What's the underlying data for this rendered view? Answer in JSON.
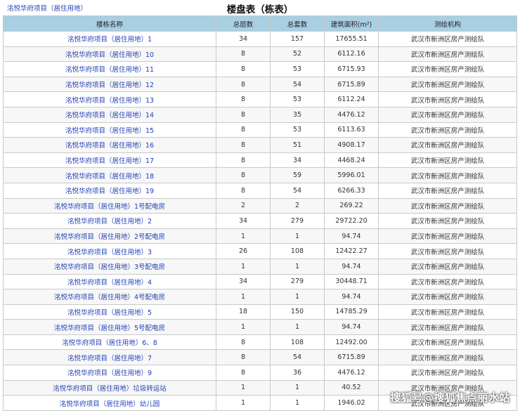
{
  "project": {
    "link_label": "洺悦华府项目（居住用地）"
  },
  "title": "楼盘表（栋表）",
  "table": {
    "headers": [
      "楼栋名称",
      "总层数",
      "总套数",
      "建筑面积(m²)",
      "测绘机构"
    ],
    "rows": [
      {
        "name": "洺悦华府项目（居住用地）1",
        "floors": "34",
        "units": "157",
        "area": "17655.51",
        "agency": "武汉市新洲区房产测绘队"
      },
      {
        "name": "洺悦华府项目（居住用地）10",
        "floors": "8",
        "units": "52",
        "area": "6112.16",
        "agency": "武汉市新洲区房产测绘队"
      },
      {
        "name": "洺悦华府项目（居住用地）11",
        "floors": "8",
        "units": "53",
        "area": "6715.93",
        "agency": "武汉市新洲区房产测绘队"
      },
      {
        "name": "洺悦华府项目（居住用地）12",
        "floors": "8",
        "units": "54",
        "area": "6715.89",
        "agency": "武汉市新洲区房产测绘队"
      },
      {
        "name": "洺悦华府项目（居住用地）13",
        "floors": "8",
        "units": "53",
        "area": "6112.24",
        "agency": "武汉市新洲区房产测绘队"
      },
      {
        "name": "洺悦华府项目（居住用地）14",
        "floors": "8",
        "units": "35",
        "area": "4476.12",
        "agency": "武汉市新洲区房产测绘队"
      },
      {
        "name": "洺悦华府项目（居住用地）15",
        "floors": "8",
        "units": "53",
        "area": "6113.63",
        "agency": "武汉市新洲区房产测绘队"
      },
      {
        "name": "洺悦华府项目（居住用地）16",
        "floors": "8",
        "units": "51",
        "area": "4908.17",
        "agency": "武汉市新洲区房产测绘队"
      },
      {
        "name": "洺悦华府项目（居住用地）17",
        "floors": "8",
        "units": "34",
        "area": "4468.24",
        "agency": "武汉市新洲区房产测绘队"
      },
      {
        "name": "洺悦华府项目（居住用地）18",
        "floors": "8",
        "units": "59",
        "area": "5996.01",
        "agency": "武汉市新洲区房产测绘队"
      },
      {
        "name": "洺悦华府项目（居住用地）19",
        "floors": "8",
        "units": "54",
        "area": "6266.33",
        "agency": "武汉市新洲区房产测绘队"
      },
      {
        "name": "洺悦华府项目（居住用地）1号配电房",
        "floors": "2",
        "units": "2",
        "area": "269.22",
        "agency": "武汉市新洲区房产测绘队"
      },
      {
        "name": "洺悦华府项目（居住用地）2",
        "floors": "34",
        "units": "279",
        "area": "29722.20",
        "agency": "武汉市新洲区房产测绘队"
      },
      {
        "name": "洺悦华府项目（居住用地）2号配电房",
        "floors": "1",
        "units": "1",
        "area": "94.74",
        "agency": "武汉市新洲区房产测绘队"
      },
      {
        "name": "洺悦华府项目（居住用地）3",
        "floors": "26",
        "units": "108",
        "area": "12422.27",
        "agency": "武汉市新洲区房产测绘队"
      },
      {
        "name": "洺悦华府项目（居住用地）3号配电房",
        "floors": "1",
        "units": "1",
        "area": "94.74",
        "agency": "武汉市新洲区房产测绘队"
      },
      {
        "name": "洺悦华府项目（居住用地）4",
        "floors": "34",
        "units": "279",
        "area": "30448.71",
        "agency": "武汉市新洲区房产测绘队"
      },
      {
        "name": "洺悦华府项目（居住用地）4号配电房",
        "floors": "1",
        "units": "1",
        "area": "94.74",
        "agency": "武汉市新洲区房产测绘队"
      },
      {
        "name": "洺悦华府项目（居住用地）5",
        "floors": "18",
        "units": "150",
        "area": "14785.29",
        "agency": "武汉市新洲区房产测绘队"
      },
      {
        "name": "洺悦华府项目（居住用地）5号配电房",
        "floors": "1",
        "units": "1",
        "area": "94.74",
        "agency": "武汉市新洲区房产测绘队"
      },
      {
        "name": "洺悦华府项目（居住用地）6、8",
        "floors": "8",
        "units": "108",
        "area": "12492.00",
        "agency": "武汉市新洲区房产测绘队"
      },
      {
        "name": "洺悦华府项目（居住用地）7",
        "floors": "8",
        "units": "54",
        "area": "6715.89",
        "agency": "武汉市新洲区房产测绘队"
      },
      {
        "name": "洺悦华府项目（居住用地）9",
        "floors": "8",
        "units": "36",
        "area": "4476.12",
        "agency": "武汉市新洲区房产测绘队"
      },
      {
        "name": "洺悦华府项目（居住用地）垃圾转运站",
        "floors": "1",
        "units": "1",
        "area": "40.52",
        "agency": "武汉市新洲区房产测绘队"
      },
      {
        "name": "洺悦华府项目（居住用地）幼儿园",
        "floors": "1",
        "units": "1",
        "area": "1946.02",
        "agency": "武汉市新洲区房产测绘队"
      }
    ]
  },
  "watermark": "搜狐号@搜狐焦点丽水站",
  "colors": {
    "link": "#1f3fb4",
    "header_bg": "#a8cfe2",
    "border": "#c9c9c9"
  }
}
